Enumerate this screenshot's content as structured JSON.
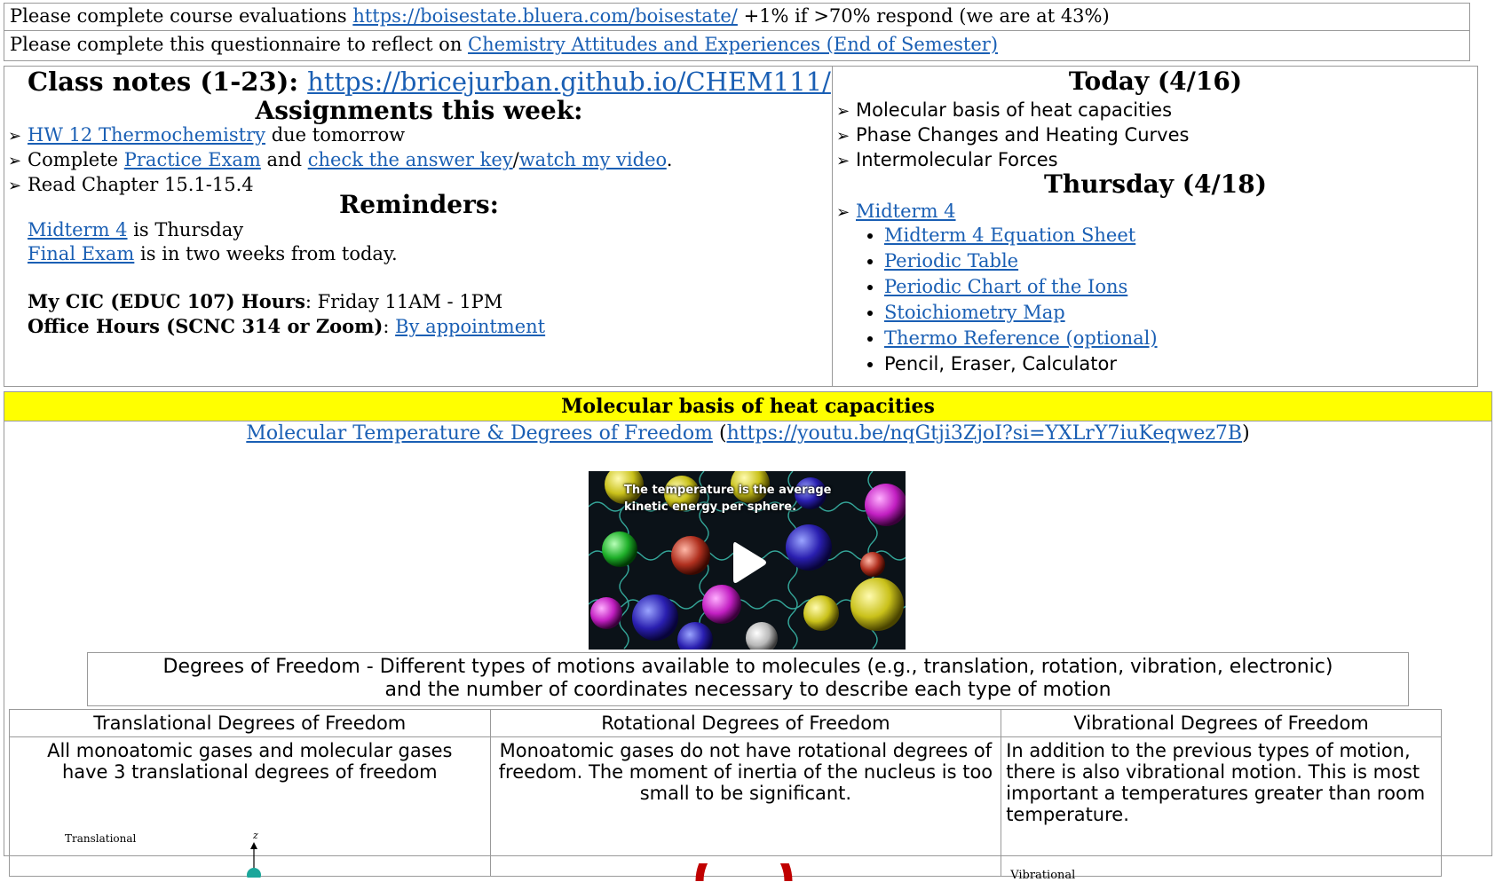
{
  "banner": {
    "eval_prefix": "Please complete course evaluations",
    "eval_link": "https://boisestate.bluera.com/boisestate/",
    "eval_suffix": "+1% if >70% respond (we are at 43%)",
    "quest_prefix": "Please complete this questionnaire to reflect on",
    "quest_link": "Chemistry Attitudes and Experiences (End of Semester)"
  },
  "left": {
    "notes_label": "Class notes (1-23):",
    "notes_link": "https://bricejurban.github.io/CHEM111/",
    "assign_heading": "Assignments this week:",
    "hw_link": "HW 12 Thermochemistry",
    "hw_suffix": "due tomorrow",
    "complete_prefix": "Complete",
    "practice_link": "Practice Exam",
    "and_text": "and",
    "answer_link": "check the answer key",
    "slash": "/",
    "video_link": "watch my video",
    "period": ".",
    "read_text": "Read Chapter 15.1-15.4",
    "reminders_heading": "Reminders:",
    "midterm_link": "Midterm 4",
    "midterm_suffix": "is Thursday",
    "final_link": "Final Exam",
    "final_suffix": "is in two weeks from today.",
    "cic_label": "My CIC (EDUC 107) Hours",
    "cic_value": ": Friday 11AM - 1PM",
    "office_label": "Office Hours (SCNC 314 or Zoom)",
    "office_colon": ":",
    "office_link": "By appointment"
  },
  "right": {
    "today_heading": "Today (4/16)",
    "today_items": [
      "Molecular basis of heat capacities",
      "Phase Changes and Heating Curves",
      "Intermolecular Forces"
    ],
    "thursday_heading": "Thursday (4/18)",
    "midterm_link": "Midterm 4",
    "sub_items": [
      "Midterm 4 Equation Sheet",
      "Periodic Table",
      "Periodic Chart of the Ions",
      "Stoichiometry Map",
      "Thermo Reference (optional)"
    ],
    "plain_item": "Pencil, Eraser, Calculator"
  },
  "section": {
    "title": "Molecular basis of heat capacities",
    "video_link": "Molecular Temperature & Degrees of Freedom",
    "paren_open": "(",
    "video_url": "https://youtu.be/nqGtji3ZjoI?si=YXLrY7iuKeqwez7B",
    "paren_close": ")",
    "video_caption_1": "The temperature is the average",
    "video_caption_2": "kinetic energy per sphere.",
    "dof_line1": "Degrees of Freedom - Different types of motions available to molecules (e.g., translation, rotation, vibration, electronic)",
    "dof_line2": "and the number of coordinates necessary to describe each type of motion"
  },
  "table": {
    "headers": [
      "Translational Degrees of Freedom",
      "Rotational Degrees of Freedom",
      "Vibrational Degrees of Freedom"
    ],
    "cells": [
      "All monoatomic gases and molecular gases have 3 translational degrees of freedom",
      "Monoatomic gases do not have rotational degrees of freedom. The moment of inertia of the nucleus is too small to be significant.",
      "In addition to the previous types of motion, there is also vibrational motion. This is most important a temperatures greater than room temperature."
    ],
    "fig_translational": "Translational",
    "fig_axis": "z",
    "fig_vibrational": "Vibrational"
  },
  "colors": {
    "link": "#1a5fb4",
    "highlight": "#ffff00"
  }
}
